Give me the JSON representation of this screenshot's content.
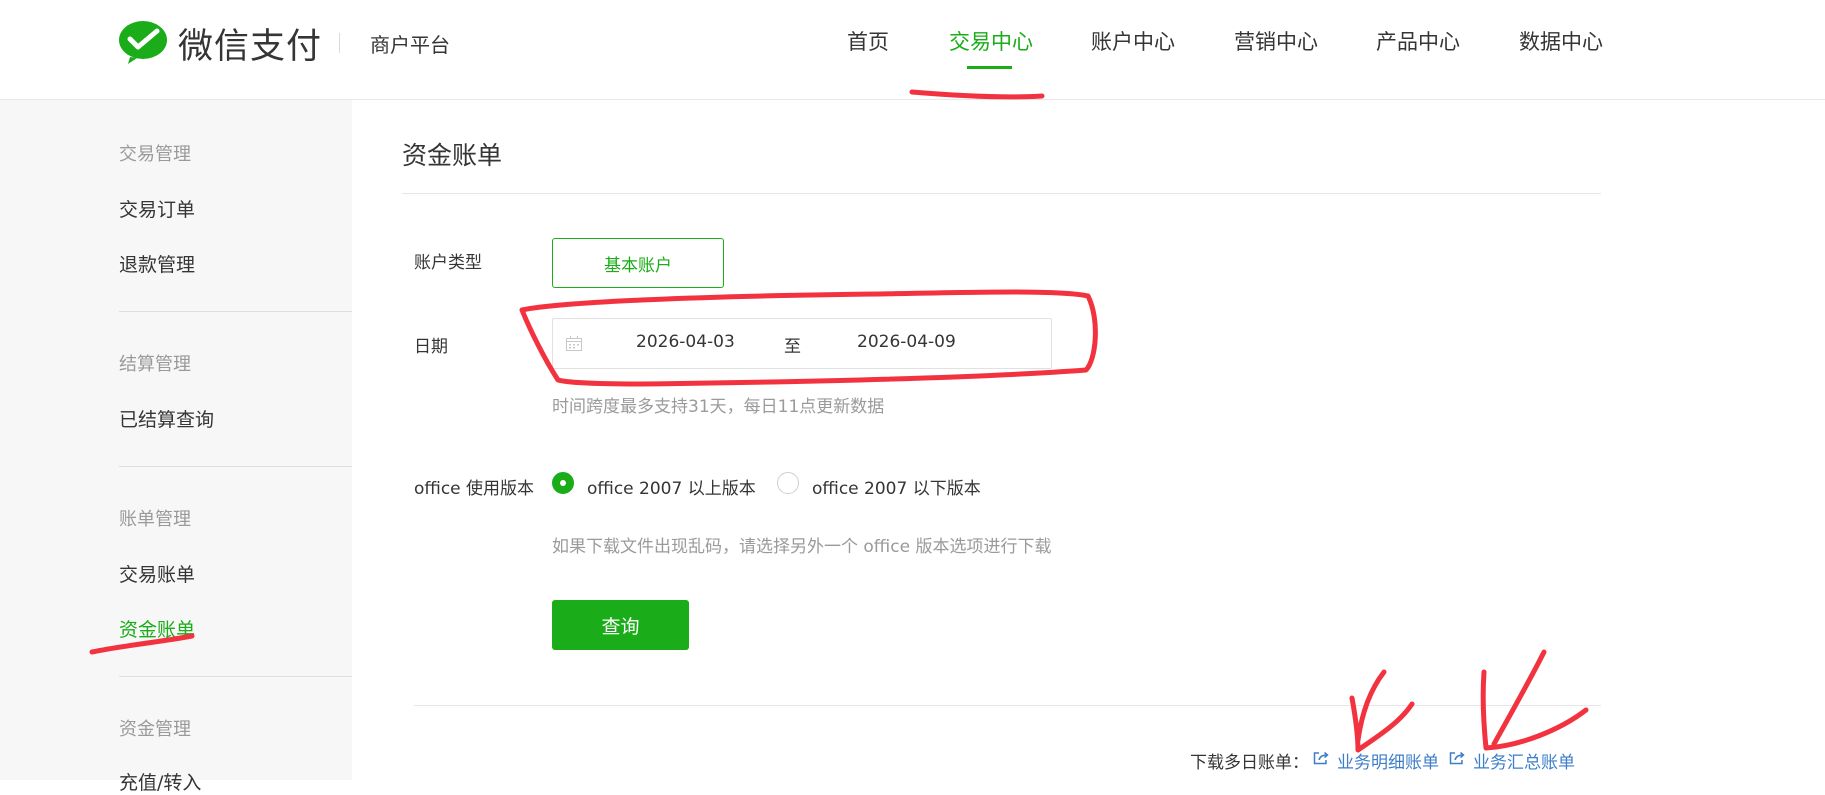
{
  "header": {
    "brand": "微信支付",
    "subbrand": "商户平台",
    "nav": [
      {
        "label": "首页",
        "active": false
      },
      {
        "label": "交易中心",
        "active": true
      },
      {
        "label": "账户中心",
        "active": false
      },
      {
        "label": "营销中心",
        "active": false
      },
      {
        "label": "产品中心",
        "active": false
      },
      {
        "label": "数据中心",
        "active": false
      }
    ]
  },
  "sidebar": {
    "groups": [
      {
        "title": "交易管理",
        "items": [
          {
            "label": "交易订单"
          },
          {
            "label": "退款管理"
          }
        ]
      },
      {
        "title": "结算管理",
        "items": [
          {
            "label": "已结算查询"
          }
        ]
      },
      {
        "title": "账单管理",
        "items": [
          {
            "label": "交易账单"
          },
          {
            "label": "资金账单",
            "active": true
          }
        ]
      },
      {
        "title": "资金管理",
        "items": [
          {
            "label": "充值/转入"
          }
        ]
      }
    ]
  },
  "main": {
    "title": "资金账单",
    "account_type": {
      "label": "账户类型",
      "value": "基本账户"
    },
    "date": {
      "label": "日期",
      "start": "2026-04-03",
      "separator": "至",
      "end": "2026-04-09",
      "hint": "时间跨度最多支持31天，每日11点更新数据"
    },
    "office": {
      "label": "office 使用版本",
      "options": [
        {
          "label": "office 2007 以上版本",
          "selected": true
        },
        {
          "label": "office 2007 以下版本",
          "selected": false
        }
      ],
      "hint": "如果下载文件出现乱码，请选择另外一个 office 版本选项进行下载"
    },
    "query_button": "查询",
    "download": {
      "label": "下载多日账单：",
      "links": [
        "业务明细账单",
        "业务汇总账单"
      ]
    }
  },
  "colors": {
    "accent": "#1aad19",
    "link": "#3d7ec9",
    "annotation": "#f2333f"
  }
}
